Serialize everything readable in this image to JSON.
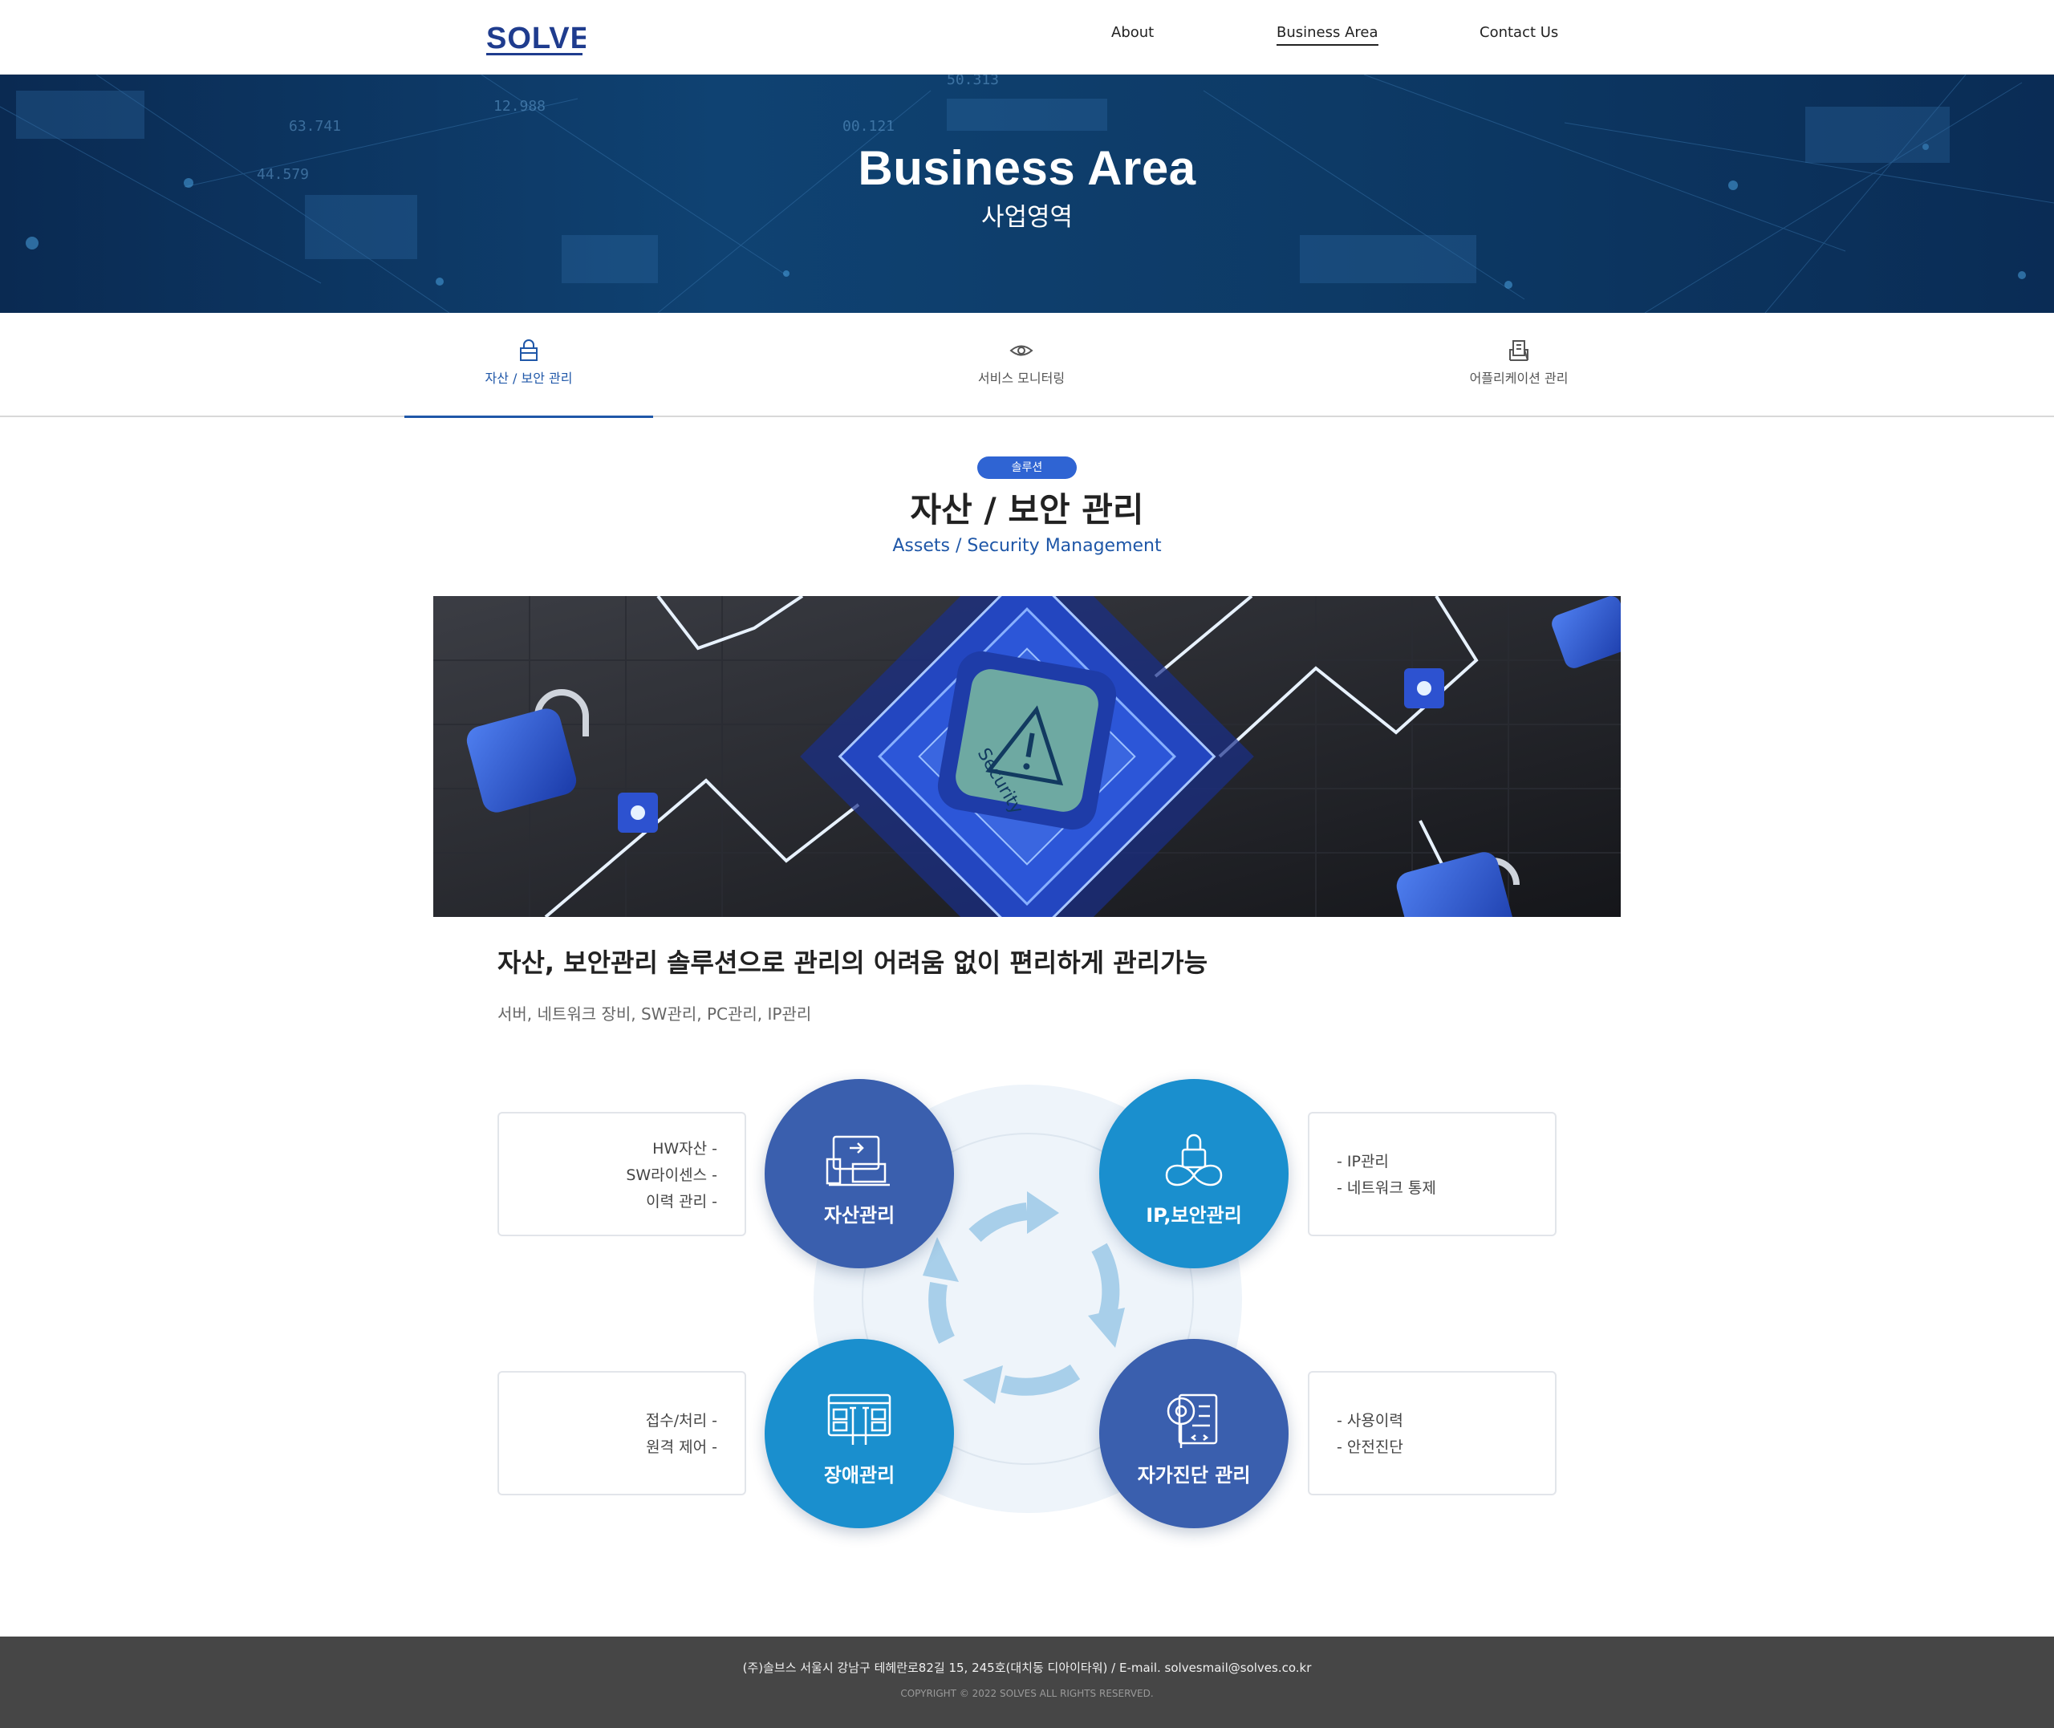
{
  "header": {
    "logo": "SOLVES",
    "nav": [
      "About",
      "Business Area",
      "Contact Us"
    ],
    "active_nav": "Business Area"
  },
  "hero": {
    "title": "Business Area",
    "subtitle": "사업영역"
  },
  "tabs": [
    {
      "label": "자산 / 보안 관리",
      "icon": "lock-icon",
      "active": true
    },
    {
      "label": "서비스 모니터링",
      "icon": "eye-icon",
      "active": false
    },
    {
      "label": "어플리케이션 관리",
      "icon": "application-icon",
      "active": false
    }
  ],
  "section": {
    "badge": "솔루션",
    "title": "자산 / 보안 관리",
    "subtitle": "Assets / Security Management",
    "banner_text": "Security",
    "headline": "자산, 보안관리 솔루션으로 관리의 어려움 없이 편리하게 관리가능",
    "items": "서버, 네트워크 장비, SW관리, PC관리, IP관리"
  },
  "diagram": {
    "nodes": [
      {
        "label": "자산관리",
        "icon": "asset-device-icon",
        "details": [
          "HW자산 -",
          "SW라이센스 -",
          "이력 관리 -"
        ]
      },
      {
        "label": "IP,보안관리",
        "icon": "security-lock-icon",
        "details": [
          "- IP관리",
          "- 네트워크 통제"
        ]
      },
      {
        "label": "장애관리",
        "icon": "repair-tools-icon",
        "details": [
          "접수/처리 -",
          "원격 제어 -"
        ]
      },
      {
        "label": "자가진단 관리",
        "icon": "diagnosis-icon",
        "details": [
          "- 사용이력",
          "- 안전진단"
        ]
      }
    ],
    "colors": {
      "dark": "#3a5fae",
      "light": "#1a8fce"
    }
  },
  "footer": {
    "address": "(주)솔브스 서울시 강남구 테헤란로82길 15, 245호(대치동 디아이타워)  /  E-mail. solvesmail@solves.co.kr",
    "copyright": "COPYRIGHT © 2022 SOLVES ALL RIGHTS RESERVED."
  }
}
